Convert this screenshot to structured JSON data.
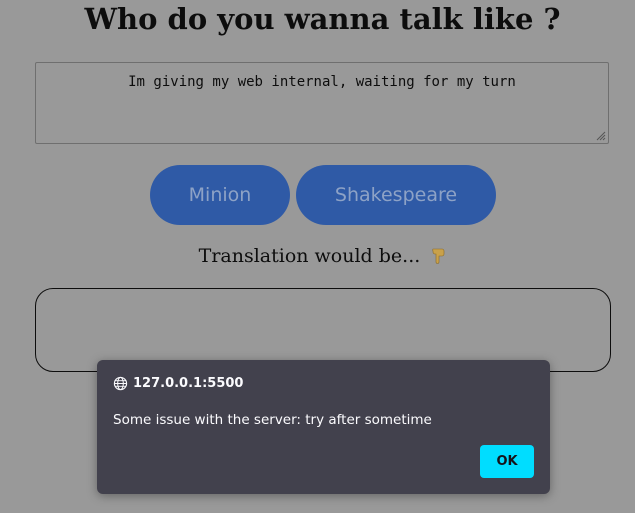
{
  "header": {
    "title": "Who do you wanna talk like ?"
  },
  "input": {
    "value": "Im giving my web internal, waiting for my turn"
  },
  "buttons": {
    "minion_label": "Minion",
    "shakespeare_label": "Shakespeare"
  },
  "translation": {
    "label": "Translation would be...",
    "icon": "pointing-down-icon",
    "output": ""
  },
  "alert": {
    "origin": "127.0.0.1:5500",
    "origin_icon": "globe-icon",
    "message": "Some issue with the server: try after sometime",
    "ok_label": "OK"
  },
  "colors": {
    "page_background": "#999999",
    "button_background": "#2f5aa6",
    "button_text": "#8da2c6",
    "dialog_background": "#42414d",
    "ok_button": "#00ddff",
    "pointer_emoji": "#c9a14a"
  }
}
